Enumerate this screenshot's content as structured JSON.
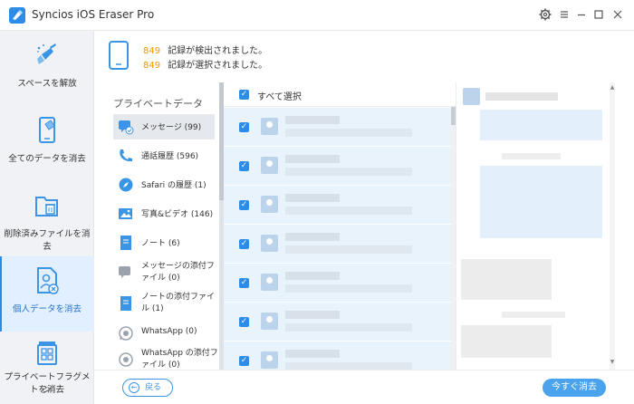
{
  "window": {
    "title": "Syncios iOS Eraser Pro",
    "controls": [
      "gear-icon",
      "menu-icon",
      "minimize-icon",
      "maximize-icon",
      "close-icon"
    ]
  },
  "sidebar": {
    "items": [
      {
        "label": "スペースを解放",
        "icon": "broom-icon",
        "active": false
      },
      {
        "label": "全てのデータを消去",
        "icon": "phone-eraser-icon",
        "active": false
      },
      {
        "label": "削除済みファイルを消去",
        "icon": "folder-trash-icon",
        "active": false
      },
      {
        "label": "個人データを消去",
        "icon": "personal-file-icon",
        "active": true
      },
      {
        "label_line1": "プライベートフラグメン",
        "label_line2": "トを消去",
        "icon": "fragment-grid-icon",
        "active": false
      }
    ]
  },
  "summary": {
    "detected_count": "849",
    "detected_text": "記録が検出されました。",
    "selected_count": "849",
    "selected_text": "記録が選択されました。"
  },
  "categories": {
    "title": "プライベートデータ",
    "items": [
      {
        "label": "メッセージ (99)",
        "icon": "message-icon",
        "active": true
      },
      {
        "label": "通話履歴 (596)",
        "icon": "phone-icon"
      },
      {
        "label": "Safari の履歴 (1)",
        "icon": "safari-icon"
      },
      {
        "label": "写真&ビデオ (146)",
        "icon": "photo-icon"
      },
      {
        "label": "ノート (6)",
        "icon": "note-icon"
      },
      {
        "line1": "メッセージの添付フ",
        "line2": "ァイル (0)",
        "icon": "message-attachment-icon"
      },
      {
        "line1": "ノートの添付ファイ",
        "line2": "ル (1)",
        "icon": "note-attachment-icon"
      },
      {
        "label": "WhatsApp (0)",
        "icon": "whatsapp-icon"
      },
      {
        "line1": "WhatsApp の添付フ",
        "line2": "ァイル (0)",
        "icon": "whatsapp-attachment-icon"
      }
    ]
  },
  "list": {
    "select_all_label": "すべて選択",
    "rows": [
      1,
      2,
      3,
      4,
      5,
      6,
      7
    ]
  },
  "footer": {
    "back_label": "戻る",
    "erase_label": "今すぐ消去"
  },
  "colors": {
    "accent": "#2d8ce8",
    "count": "#f39800",
    "active_bg": "#e1efff"
  }
}
